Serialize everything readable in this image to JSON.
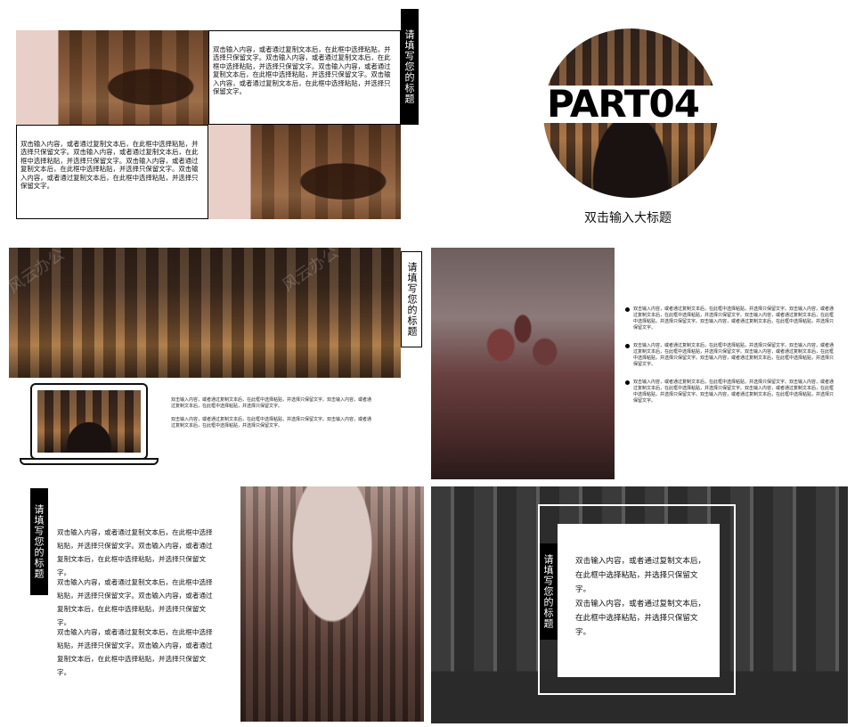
{
  "slide1": {
    "vertical_title": "请填写您的标题",
    "text_top": "双击输入内容，或者通过复制文本后，在此框中选择粘贴，并选择只保留文字。双击输入内容，或者通过复制文本后，在此框中选择粘贴，并选择只保留文字。双击输入内容，或者通过复制文本后，在此框中选择粘贴，并选择只保留文字。双击输入内容，或者通过复制文本后，在此框中选择粘贴，并选择只保留文字。",
    "text_bottom": "双击输入内容，或者通过复制文本后，在此框中选择粘贴，并选择只保留文字。双击输入内容，或者通过复制文本后，在此框中选择粘贴，并选择只保留文字。双击输入内容，或者通过复制文本后，在此框中选择粘贴，并选择只保留文字。双击输入内容，或者通过复制文本后，在此框中选择粘贴，并选择只保留文字。"
  },
  "slide2": {
    "part_label": "PART04",
    "subtitle": "双击输入大标题"
  },
  "slide3": {
    "watermark_left": "风云办公",
    "watermark_right": "风云办公",
    "vertical_title": "请填写您的标题",
    "para1": "双击输入内容，或者通过复制文本后，在此框中选择粘贴，并选择只保留文字。双击输入内容，或者通过复制文本后，在此框中选择粘贴，并选择只保留文字。",
    "para2": "双击输入内容，或者通过复制文本后，在此框中选择粘贴，并选择只保留文字。双击输入内容，或者通过复制文本后，在此框中选择粘贴，并选择只保留文字。"
  },
  "slide4": {
    "bullets": [
      "双击输入内容，或者通过复制文本后，在此框中选择粘贴，并选择只保留文字。双击输入内容，或者通过复制文本后，在此框中选择粘贴，并选择只保留文字。双击输入内容，或者通过复制文本后，在此框中选择粘贴，并选择只保留文字。双击输入内容，或者通过复制文本后，在此框中选择粘贴，并选择只保留文字。",
      "双击输入内容，或者通过复制文本后，在此框中选择粘贴，并选择只保留文字。双击输入内容，或者通过复制文本后，在此框中选择粘贴，并选择只保留文字。双击输入内容，或者通过复制文本后，在此框中选择粘贴，并选择只保留文字。双击输入内容，或者通过复制文本后，在此框中选择粘贴，并选择只保留文字。",
      "双击输入内容，或者通过复制文本后，在此框中选择粘贴，并选择只保留文字。双击输入内容，或者通过复制文本后，在此框中选择粘贴，并选择只保留文字。双击输入内容，或者通过复制文本后，在此框中选择粘贴，并选择只保留文字。双击输入内容，或者通过复制文本后，在此框中选择粘贴，并选择只保留文字。"
    ]
  },
  "slide5": {
    "vertical_title": "请填写您的标题",
    "para1": "双击输入内容，或者通过复制文本后，在此框中选择粘贴，并选择只保留文字。双击输入内容，或者通过复制文本后，在此框中选择粘贴，并选择只保留文字。",
    "para2": "双击输入内容，或者通过复制文本后，在此框中选择粘贴，并选择只保留文字。双击输入内容，或者通过复制文本后，在此框中选择粘贴，并选择只保留文字。",
    "para3": "双击输入内容，或者通过复制文本后，在此框中选择粘贴，并选择只保留文字。双击输入内容，或者通过复制文本后，在此框中选择粘贴，并选择只保留文字。"
  },
  "slide6": {
    "vertical_title": "请填写您的标题",
    "para1": "双击输入内容，或者通过复制文本后，在此框中选择粘贴，并选择只保留文字。",
    "para2": "双击输入内容，或者通过复制文本后，在此框中选择粘贴，并选择只保留文字。"
  },
  "colors": {
    "accent": "#000000",
    "sepia": "#7a5236",
    "background": "#ffffff"
  }
}
